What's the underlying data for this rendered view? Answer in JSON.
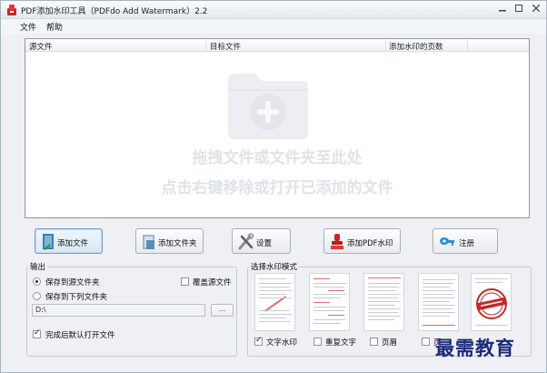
{
  "window": {
    "title": "PDF添加水印工具（PDFdo Add Watermark）2.2",
    "icon": "pdf-app-icon"
  },
  "window_controls": {
    "minimize": "–",
    "maximize": "□",
    "close": "✕"
  },
  "menu": {
    "file": "文件",
    "help": "帮助"
  },
  "file_list": {
    "columns": [
      "源文件",
      "目标文件",
      "添加水印的页数"
    ],
    "placeholder_icon": "add-folder-icon",
    "hint_line1": "拖拽文件或文件夹至此处",
    "hint_line2": "点击右键移除或打开已添加的文件"
  },
  "toolbar": {
    "add_file": "添加文件",
    "add_folder": "添加文件夹",
    "settings": "设置",
    "add_pdf_watermark": "添加PDF水印",
    "register": "注册"
  },
  "output": {
    "title": "输出",
    "save_to_source": "保存到源文件夹",
    "save_to_folder": "保存到下列文件夹",
    "overwrite_source": "覆盖源文件",
    "path_value": "D:\\",
    "browse_label": "...",
    "open_after": "完成后默认打开文件",
    "selected_option": "save_to_source",
    "overwrite_checked": false,
    "open_after_checked": true
  },
  "watermark_mode": {
    "title": "选择水印模式",
    "options": [
      {
        "label": "文字水印",
        "checked": true
      },
      {
        "label": "重复文字",
        "checked": false
      },
      {
        "label": "页眉",
        "checked": false
      },
      {
        "label": "页",
        "checked": false
      }
    ]
  },
  "brand_watermark": "最需教育",
  "colors": {
    "window_bg": "#eef0f3",
    "accent_blue": "#6e9ec9",
    "stamp_red": "#c62828",
    "brand_blue": "#1b2a7a"
  }
}
